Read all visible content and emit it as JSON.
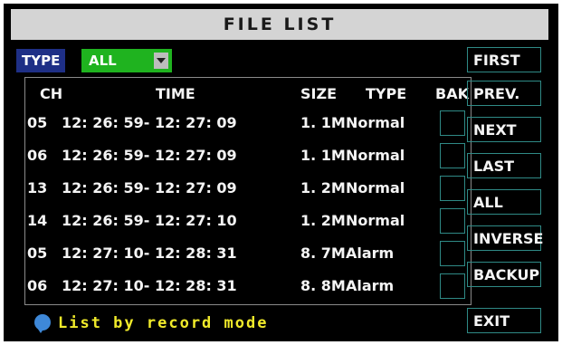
{
  "title": "FILE LIST",
  "filter": {
    "label": "TYPE",
    "value": "ALL"
  },
  "columns": [
    "CH",
    "TIME",
    "SIZE",
    "TYPE",
    "BAK"
  ],
  "rows": [
    {
      "ch": "05",
      "time": "12: 26: 59- 12: 27: 09",
      "size": "1. 1M",
      "type": "Normal"
    },
    {
      "ch": "06",
      "time": "12: 26: 59- 12: 27: 09",
      "size": "1. 1M",
      "type": "Normal"
    },
    {
      "ch": "13",
      "time": "12: 26: 59- 12: 27: 09",
      "size": "1. 2M",
      "type": "Normal"
    },
    {
      "ch": "14",
      "time": "12: 26: 59- 12: 27: 10",
      "size": "1. 2M",
      "type": "Normal"
    },
    {
      "ch": "05",
      "time": "12: 27: 10- 12: 28: 31",
      "size": "8. 7M",
      "type": "Alarm"
    },
    {
      "ch": "06",
      "time": "12: 27: 10- 12: 28: 31",
      "size": "8. 8M",
      "type": "Alarm"
    }
  ],
  "buttons": {
    "first": "FIRST",
    "prev": "PREV.",
    "next": "NEXT",
    "last": "LAST",
    "all": "ALL",
    "inverse": "INVERSE",
    "backup": "BACKUP",
    "exit": "EXIT"
  },
  "hint": "List by record mode",
  "colors": {
    "title_bg": "#d4d4d4",
    "type_label_bg": "#1e2f86",
    "select_bg": "#1fb31f",
    "border": "#2f8a86",
    "hint": "#f0ea2a"
  }
}
